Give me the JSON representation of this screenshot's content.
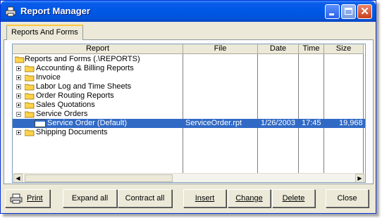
{
  "window": {
    "title": "Report Manager",
    "title_icon": "printer-icon"
  },
  "tab": {
    "label": "Reports And Forms"
  },
  "columns": [
    {
      "label": "Report"
    },
    {
      "label": "File"
    },
    {
      "label": "Date"
    },
    {
      "label": "Time"
    },
    {
      "label": "Size"
    }
  ],
  "rows": [
    {
      "label": "Reports and Forms (.\\REPORTS)",
      "type": "folder-root"
    },
    {
      "label": "Accounting & Billing Reports",
      "type": "folder",
      "expander": "+"
    },
    {
      "label": "Invoice",
      "type": "folder",
      "expander": "+"
    },
    {
      "label": "Labor Log and Time Sheets",
      "type": "folder",
      "expander": "+"
    },
    {
      "label": "Order Routing Reports",
      "type": "folder",
      "expander": "+"
    },
    {
      "label": "Sales Quotations",
      "type": "folder",
      "expander": "+"
    },
    {
      "label": "Service Orders",
      "type": "folder",
      "expander": "-"
    },
    {
      "label": "Service Order (Default)",
      "type": "file",
      "file": "ServiceOrder.rpt",
      "date": "1/26/2003",
      "time": "17:45",
      "size": "19,968",
      "selected": true
    },
    {
      "label": "Shipping Documents",
      "type": "folder",
      "expander": "+"
    }
  ],
  "buttons": {
    "print": "Print",
    "expand_all": "Expand all",
    "contract_all": "Contract all",
    "insert": "Insert",
    "change": "Change",
    "delete": "Delete",
    "close": "Close"
  }
}
